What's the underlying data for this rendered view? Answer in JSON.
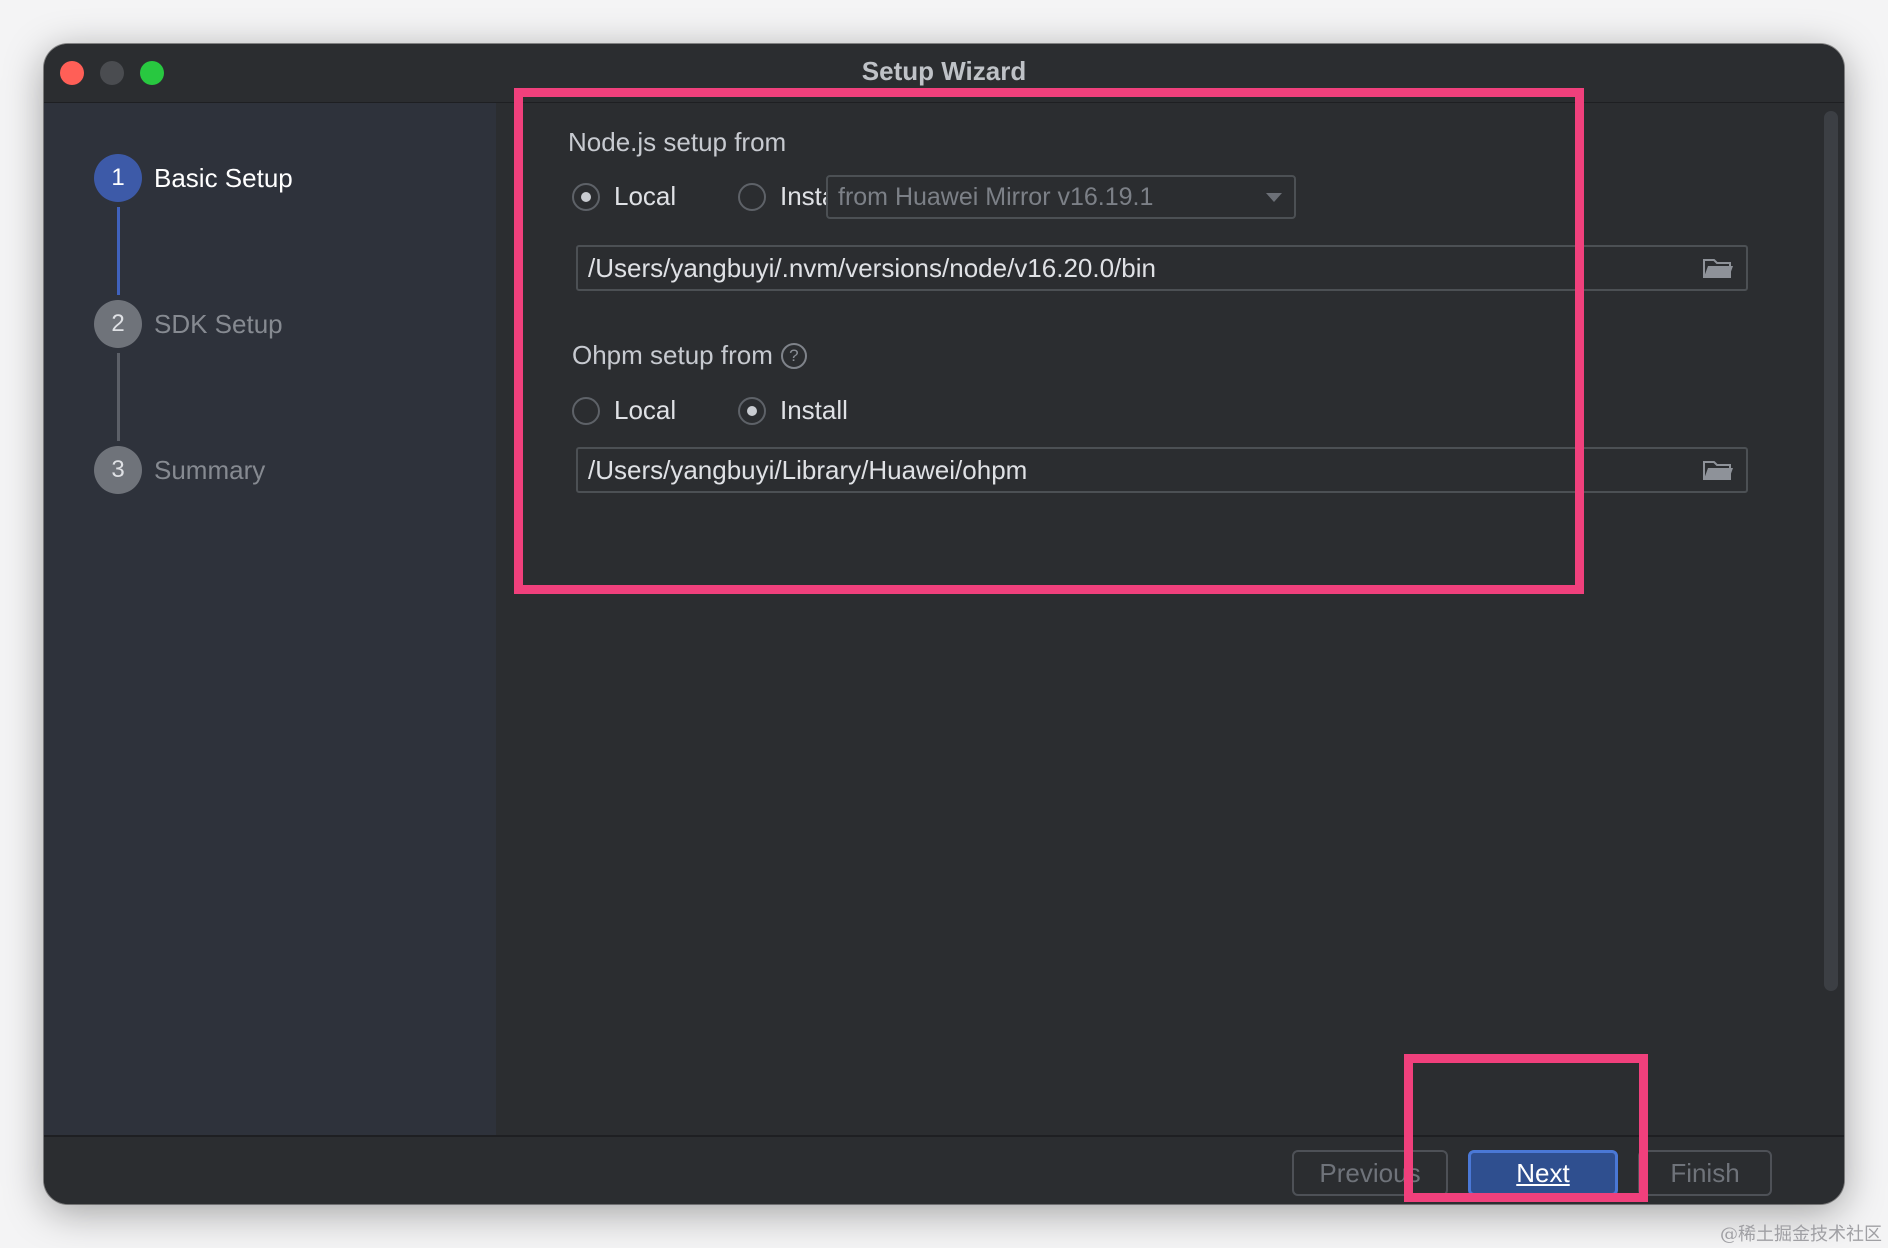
{
  "window": {
    "title": "Setup Wizard"
  },
  "steps": [
    {
      "number": "1",
      "label": "Basic Setup",
      "state": "active"
    },
    {
      "number": "2",
      "label": "SDK Setup",
      "state": "inactive"
    },
    {
      "number": "3",
      "label": "Summary",
      "state": "inactive"
    }
  ],
  "node": {
    "section_label": "Node.js setup from",
    "option_local": "Local",
    "option_install": "Install",
    "selected": "Local",
    "mirror_select": "from Huawei Mirror v16.19.1",
    "path": "/Users/yangbuyi/.nvm/versions/node/v16.20.0/bin"
  },
  "ohpm": {
    "section_label": "Ohpm setup from",
    "help_glyph": "?",
    "option_local": "Local",
    "option_install": "Install",
    "selected": "Install",
    "path": "/Users/yangbuyi/Library/Huawei/ohpm"
  },
  "footer": {
    "previous_label": "Previous",
    "next_label": "Next",
    "finish_label": "Finish"
  },
  "watermark": "@稀土掘金技术社区",
  "colors": {
    "accent": "#3d5aa8",
    "highlight": "#f0407c",
    "background": "#2b2d30",
    "sidebar": "#2e323b"
  },
  "icons": [
    "folder-icon",
    "help-icon",
    "chevron-down-icon"
  ]
}
